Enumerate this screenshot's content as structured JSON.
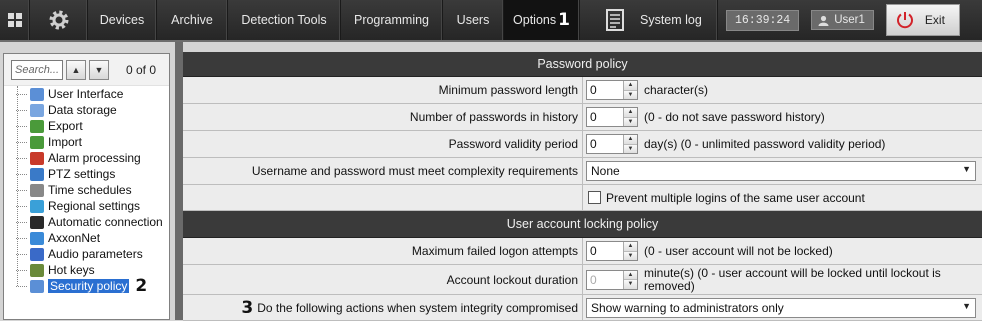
{
  "topbar": {
    "tabs": [
      {
        "label": "Devices"
      },
      {
        "label": "Archive"
      },
      {
        "label": "Detection Tools"
      },
      {
        "label": "Programming"
      },
      {
        "label": "Users"
      },
      {
        "label": "Options"
      }
    ],
    "options_annotation": "1",
    "system_log": "System log",
    "clock": "16:39:24",
    "user": "User1",
    "exit": "Exit"
  },
  "left": {
    "search_placeholder": "Search...",
    "counter": "0 of 0",
    "items": [
      {
        "label": "User Interface",
        "icon": "monitor-icon",
        "color": "#5b8fd6"
      },
      {
        "label": "Data storage",
        "icon": "storage-icon",
        "color": "#7aa6e0"
      },
      {
        "label": "Export",
        "icon": "export-icon",
        "color": "#4a9a3a"
      },
      {
        "label": "Import",
        "icon": "import-icon",
        "color": "#4a9a3a"
      },
      {
        "label": "Alarm processing",
        "icon": "alarm-icon",
        "color": "#c83a2a"
      },
      {
        "label": "PTZ settings",
        "icon": "ptz-icon",
        "color": "#3a7ac8"
      },
      {
        "label": "Time schedules",
        "icon": "clock-icon",
        "color": "#888888"
      },
      {
        "label": "Regional settings",
        "icon": "globe-icon",
        "color": "#3aa0d8"
      },
      {
        "label": "Automatic connection",
        "icon": "terminal-icon",
        "color": "#2a2a2a"
      },
      {
        "label": "AxxonNet",
        "icon": "cloud-icon",
        "color": "#3a8ad8"
      },
      {
        "label": "Audio parameters",
        "icon": "audio-icon",
        "color": "#3a6ac8"
      },
      {
        "label": "Hot keys",
        "icon": "keyboard-icon",
        "color": "#6a8a3a"
      },
      {
        "label": "Security policy",
        "icon": "shield-icon",
        "color": "#5b8fd6"
      }
    ],
    "security_annotation": "2"
  },
  "main": {
    "password_policy": {
      "title": "Password policy",
      "min_length_label": "Minimum password length",
      "min_length_value": "0",
      "min_length_unit": "character(s)",
      "history_label": "Number of passwords in history",
      "history_value": "0",
      "history_note": "(0 - do not save password history)",
      "validity_label": "Password validity period",
      "validity_value": "0",
      "validity_note": "day(s) (0 - unlimited password validity period)",
      "complexity_label": "Username and password must meet complexity requirements",
      "complexity_value": "None",
      "prevent_multiple_label": "Prevent multiple logins of the same user account"
    },
    "locking_policy": {
      "title": "User account locking policy",
      "failed_label": "Maximum failed logon attempts",
      "failed_value": "0",
      "failed_note": "(0 - user account will not be locked)",
      "duration_label": "Account lockout duration",
      "duration_value": "0",
      "duration_note_1": "minute(s) (0 - user account will be locked until lockout is",
      "duration_note_2": "removed)",
      "integrity_annotation": "3",
      "integrity_label": "Do the following actions when system integrity compromised",
      "integrity_value": "Show warning to administrators only"
    }
  }
}
